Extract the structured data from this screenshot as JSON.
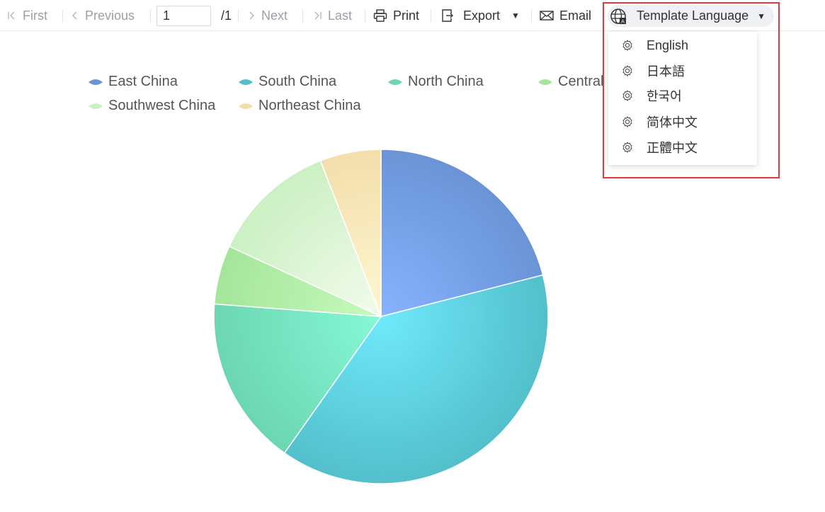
{
  "toolbar": {
    "first": "First",
    "previous": "Previous",
    "page_value": "1",
    "page_total": "/1",
    "next": "Next",
    "last": "Last",
    "print": "Print",
    "export": "Export",
    "email": "Email",
    "template_language": "Template Language"
  },
  "language_menu": {
    "items": [
      {
        "label": "English",
        "icon": "gear-icon"
      },
      {
        "label": "日本語",
        "icon": "gear-icon"
      },
      {
        "label": "한국어",
        "icon": "gear-icon"
      },
      {
        "label": "简体中文",
        "icon": "gear-icon"
      },
      {
        "label": "正體中文",
        "icon": "gear-icon"
      }
    ]
  },
  "colors": {
    "highlight": "#e0393e",
    "disabled_text": "#9aa0a6"
  },
  "chart_data": {
    "type": "pie",
    "title": "",
    "categories": [
      "East China",
      "South China",
      "North China",
      "Central",
      "Southwest China",
      "Northeast China"
    ],
    "values": [
      21.0,
      38.8,
      16.4,
      5.7,
      12.2,
      5.9
    ],
    "legend": {
      "visible_labels": [
        "East China",
        "South China",
        "North China",
        "Central",
        "Southwest China",
        "Northeast China"
      ],
      "placement": "top"
    },
    "series_colors": [
      {
        "edge": "#6a94d6",
        "center": "#87b3ff"
      },
      {
        "edge": "#53bfcb",
        "center": "#6fe9fb"
      },
      {
        "edge": "#6cd6b2",
        "center": "#86f8d6"
      },
      {
        "edge": "#a5e59b",
        "center": "#c7fabd"
      },
      {
        "edge": "#ccf0c4",
        "center": "#f3fbec"
      },
      {
        "edge": "#f3deab",
        "center": "#fef7d2"
      }
    ]
  }
}
